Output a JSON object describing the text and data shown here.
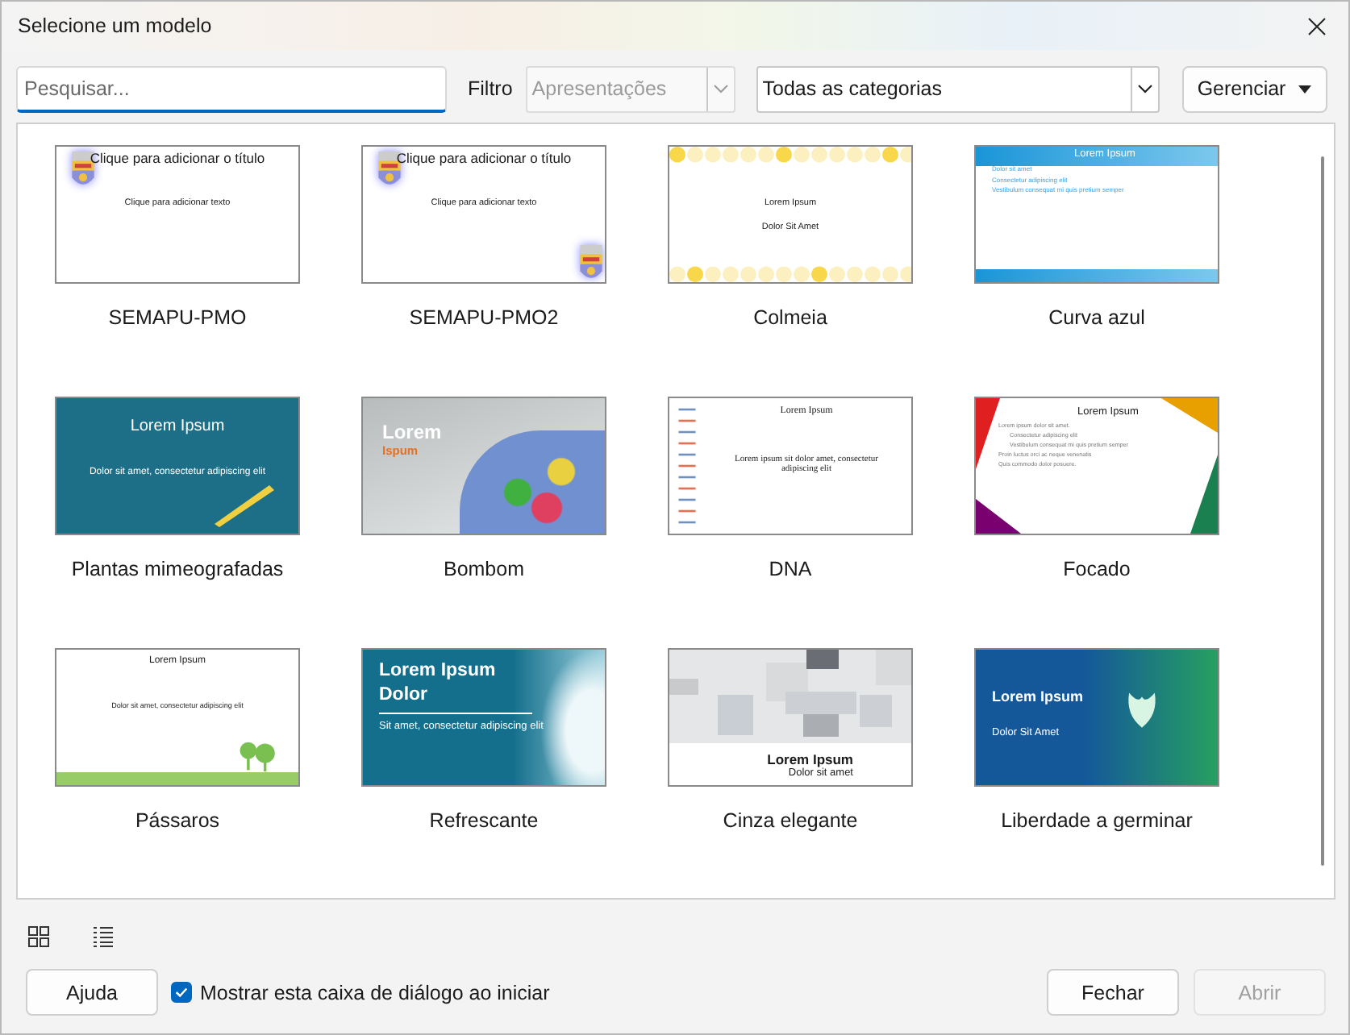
{
  "window": {
    "title": "Selecione um modelo"
  },
  "search": {
    "placeholder": "Pesquisar..."
  },
  "filter": {
    "label": "Filtro",
    "document_type": {
      "value": "Apresentações",
      "disabled": true
    },
    "category": {
      "value": "Todas as categorias",
      "disabled": false
    }
  },
  "manage_button": {
    "label": "Gerenciar"
  },
  "templates": [
    {
      "name": "SEMAPU-PMO",
      "kind": "semapu",
      "lines": [
        {
          "text": "Clique para adicionar o título",
          "kind": "title"
        },
        {
          "text": "Clique para adicionar texto",
          "kind": "body"
        }
      ]
    },
    {
      "name": "SEMAPU-PMO2",
      "kind": "semapu2",
      "lines": [
        {
          "text": "Clique para adicionar o título",
          "kind": "title"
        },
        {
          "text": "Clique para adicionar texto",
          "kind": "body"
        }
      ]
    },
    {
      "name": "Colmeia",
      "kind": "colmeia",
      "lines": [
        {
          "text": "Lorem Ipsum",
          "kind": "title"
        },
        {
          "text": "Dolor Sit Amet",
          "kind": "body"
        }
      ]
    },
    {
      "name": "Curva azul",
      "kind": "curva",
      "lines": [
        {
          "text": "Lorem Ipsum",
          "kind": "title"
        },
        {
          "text": "Dolor sit amet",
          "kind": "bullet"
        },
        {
          "text": "Consectetur adipiscing elit",
          "kind": "bullet"
        },
        {
          "text": "Vestibulum consequat mi quis pretium semper",
          "kind": "bullet"
        }
      ]
    },
    {
      "name": "Plantas mimeografadas",
      "kind": "plantas",
      "lines": [
        {
          "text": "Lorem Ipsum",
          "kind": "title"
        },
        {
          "text": "Dolor sit amet, consectetur adipiscing elit",
          "kind": "body"
        }
      ]
    },
    {
      "name": "Bombom",
      "kind": "bombom",
      "lines": [
        {
          "text": "Lorem",
          "kind": "title"
        },
        {
          "text": "Ispum",
          "kind": "accent"
        }
      ]
    },
    {
      "name": "DNA",
      "kind": "dna",
      "lines": [
        {
          "text": "Lorem Ipsum",
          "kind": "title"
        },
        {
          "text": "Lorem ipsum sit dolor amet, consectetur adipiscing elit",
          "kind": "body"
        }
      ]
    },
    {
      "name": "Focado",
      "kind": "focado",
      "lines": [
        {
          "text": "Lorem Ipsum",
          "kind": "title"
        },
        {
          "text": "Lorem ipsum dolor sit amet.",
          "kind": "bullet"
        },
        {
          "text": "Consectetur adipiscing elit",
          "kind": "subbullet"
        },
        {
          "text": "Vestibulum consequat mi quis pretium semper",
          "kind": "subbullet"
        },
        {
          "text": "Proin luctus orci ac neque venenatis",
          "kind": "bullet"
        },
        {
          "text": "Quis commodo dolor posuere.",
          "kind": "bullet"
        }
      ]
    },
    {
      "name": "Pássaros",
      "kind": "passaros",
      "lines": [
        {
          "text": "Lorem Ipsum",
          "kind": "title"
        },
        {
          "text": "Dolor sit amet, consectetur adipiscing elit",
          "kind": "body"
        }
      ]
    },
    {
      "name": "Refrescante",
      "kind": "refrescante",
      "lines": [
        {
          "text": "Lorem Ipsum Dolor",
          "kind": "title"
        },
        {
          "text": "Sit amet, consectetur adipiscing elit",
          "kind": "body"
        }
      ]
    },
    {
      "name": "Cinza elegante",
      "kind": "cinza",
      "lines": [
        {
          "text": "Lorem Ipsum",
          "kind": "title"
        },
        {
          "text": "Dolor sit amet",
          "kind": "body"
        }
      ]
    },
    {
      "name": "Liberdade a germinar",
      "kind": "liberdade",
      "lines": [
        {
          "text": "Lorem Ipsum",
          "kind": "title"
        },
        {
          "text": "Dolor Sit Amet",
          "kind": "body"
        }
      ]
    }
  ],
  "view_modes": [
    {
      "kind": "grid"
    },
    {
      "kind": "list"
    }
  ],
  "footer": {
    "help_button": "Ajuda",
    "show_on_start": {
      "label": "Mostrar esta caixa de diálogo ao iniciar",
      "checked": true
    },
    "buttons": [
      {
        "label": "Fechar",
        "disabled": false
      },
      {
        "label": "Abrir",
        "disabled": true
      }
    ]
  }
}
